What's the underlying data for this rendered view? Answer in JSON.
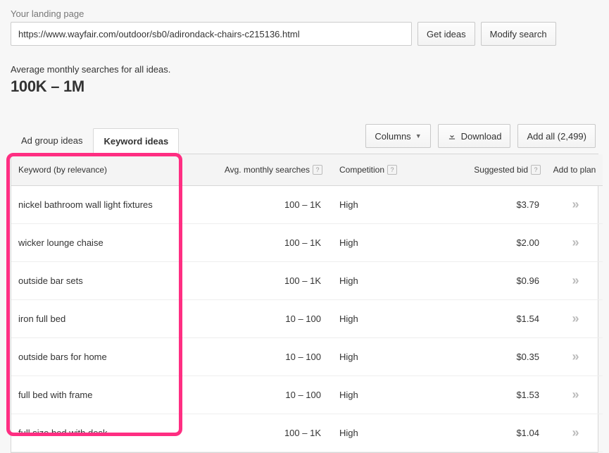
{
  "input": {
    "label": "Your landing page",
    "value": "https://www.wayfair.com/outdoor/sb0/adirondack-chairs-c215136.html"
  },
  "buttons": {
    "get_ideas": "Get ideas",
    "modify_search": "Modify search",
    "columns": "Columns",
    "download": "Download",
    "add_all": "Add all (2,499)"
  },
  "stats": {
    "label": "Average monthly searches for all ideas.",
    "value": "100K – 1M"
  },
  "tabs": {
    "ad_group": "Ad group ideas",
    "keyword": "Keyword ideas"
  },
  "headers": {
    "keyword": "Keyword (by relevance)",
    "searches": "Avg. monthly searches",
    "competition": "Competition",
    "bid": "Suggested bid",
    "add": "Add to plan"
  },
  "rows": [
    {
      "keyword": "nickel bathroom wall light fixtures",
      "searches": "100 – 1K",
      "competition": "High",
      "bid": "$3.79"
    },
    {
      "keyword": "wicker lounge chaise",
      "searches": "100 – 1K",
      "competition": "High",
      "bid": "$2.00"
    },
    {
      "keyword": "outside bar sets",
      "searches": "100 – 1K",
      "competition": "High",
      "bid": "$0.96"
    },
    {
      "keyword": "iron full bed",
      "searches": "10 – 100",
      "competition": "High",
      "bid": "$1.54"
    },
    {
      "keyword": "outside bars for home",
      "searches": "10 – 100",
      "competition": "High",
      "bid": "$0.35"
    },
    {
      "keyword": "full bed with frame",
      "searches": "10 – 100",
      "competition": "High",
      "bid": "$1.53"
    },
    {
      "keyword": "full size bed with desk",
      "searches": "100 – 1K",
      "competition": "High",
      "bid": "$1.04"
    }
  ]
}
